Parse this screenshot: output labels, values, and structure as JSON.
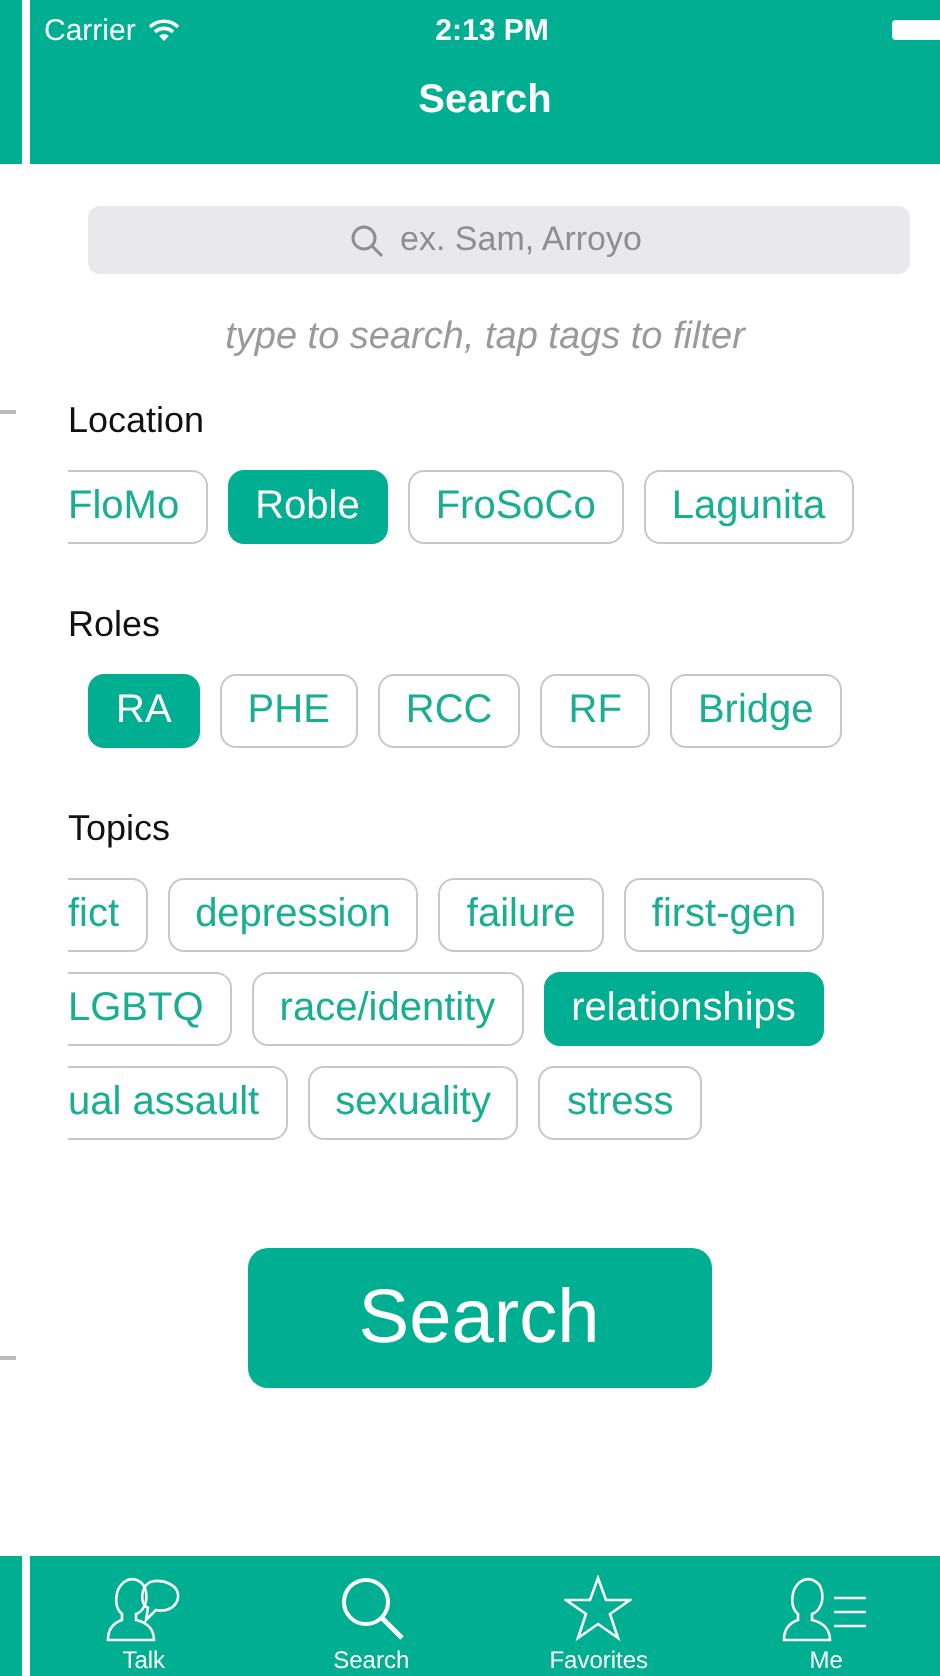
{
  "status_bar": {
    "carrier": "Carrier",
    "time": "2:13 PM"
  },
  "nav": {
    "title": "Search"
  },
  "search": {
    "placeholder": "ex. Sam, Arroyo"
  },
  "hint": "type to search, tap tags to filter",
  "sections": [
    {
      "title": "Location",
      "rows": [
        [
          {
            "label": "FloMo",
            "selected": false,
            "kind": "clipped"
          },
          {
            "label": "Roble",
            "selected": true,
            "kind": "full"
          },
          {
            "label": "FroSoCo",
            "selected": false,
            "kind": "full"
          },
          {
            "label": "Lagunita",
            "selected": false,
            "kind": "full"
          }
        ]
      ]
    },
    {
      "title": "Roles",
      "rows": [
        [
          {
            "label": "RA",
            "selected": true,
            "kind": "full"
          },
          {
            "label": "PHE",
            "selected": false,
            "kind": "full"
          },
          {
            "label": "RCC",
            "selected": false,
            "kind": "full"
          },
          {
            "label": "RF",
            "selected": false,
            "kind": "full"
          },
          {
            "label": "Bridge",
            "selected": false,
            "kind": "full"
          }
        ]
      ]
    },
    {
      "title": "Topics",
      "rows": [
        [
          {
            "label": "fict",
            "selected": false,
            "kind": "clipped"
          },
          {
            "label": "depression",
            "selected": false,
            "kind": "full"
          },
          {
            "label": "failure",
            "selected": false,
            "kind": "full"
          },
          {
            "label": "first-gen",
            "selected": false,
            "kind": "full"
          }
        ],
        [
          {
            "label": "LGBTQ",
            "selected": false,
            "kind": "clipped"
          },
          {
            "label": "race/identity",
            "selected": false,
            "kind": "full"
          },
          {
            "label": "relationships",
            "selected": true,
            "kind": "full"
          }
        ],
        [
          {
            "label": "ual assault",
            "selected": false,
            "kind": "clipped"
          },
          {
            "label": "sexuality",
            "selected": false,
            "kind": "full"
          },
          {
            "label": "stress",
            "selected": false,
            "kind": "full"
          }
        ]
      ]
    }
  ],
  "search_button": "Search",
  "tabs": [
    {
      "label": "Talk",
      "kind": "talk"
    },
    {
      "label": "Search",
      "kind": "search"
    },
    {
      "label": "Favorites",
      "kind": "favorites"
    },
    {
      "label": "Me",
      "kind": "me"
    }
  ]
}
